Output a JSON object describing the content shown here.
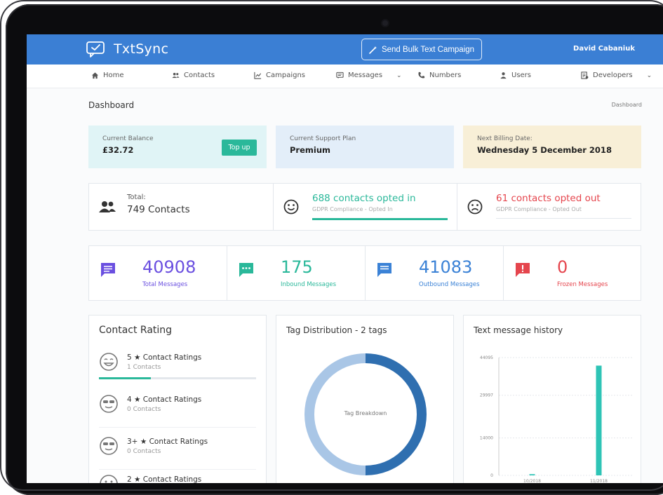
{
  "app": {
    "name": "TxtSync",
    "bulk_button": "Send Bulk Text Campaign",
    "user_name": "David Cabaniuk"
  },
  "nav": {
    "items": [
      {
        "label": "Home",
        "icon": "home-icon"
      },
      {
        "label": "Contacts",
        "icon": "contacts-icon"
      },
      {
        "label": "Campaigns",
        "icon": "chart-icon"
      },
      {
        "label": "Messages",
        "icon": "message-icon",
        "dropdown": true
      },
      {
        "label": "Numbers",
        "icon": "phone-icon"
      },
      {
        "label": "Users",
        "icon": "user-icon"
      },
      {
        "label": "Developers",
        "icon": "code-icon",
        "dropdown": true
      }
    ]
  },
  "page": {
    "title": "Dashboard",
    "breadcrumb": "Dashboard"
  },
  "info_cards": {
    "balance": {
      "label": "Current Balance",
      "value": "£32.72",
      "button": "Top up",
      "bg": "#e0f4f6"
    },
    "plan": {
      "label": "Current Support Plan",
      "value": "Premium",
      "bg": "#e3eef9"
    },
    "billing": {
      "label": "Next Billing Date:",
      "value": "Wednesday 5 December 2018",
      "bg": "#f8efd7"
    }
  },
  "contacts": {
    "total_label": "Total:",
    "total_value": "749 Contacts",
    "opted_in": {
      "title": "688 contacts opted in",
      "sub": "GDPR Compliance - Opted In",
      "color": "#2ab89a",
      "progress": 1.0
    },
    "opted_out": {
      "title": "61 contacts opted out",
      "sub": "GDPR Compliance - Opted Out",
      "color": "#e5454d",
      "progress": 0
    }
  },
  "messages": [
    {
      "value": "40908",
      "label": "Total Messages",
      "color": "#6a4fe0",
      "icon": "message-icon"
    },
    {
      "value": "175",
      "label": "Inbound Messages",
      "color": "#2ab89a",
      "icon": "inbound-icon"
    },
    {
      "value": "41083",
      "label": "Outbound Messages",
      "color": "#3b82d6",
      "icon": "outbound-icon"
    },
    {
      "value": "0",
      "label": "Frozen Messages",
      "color": "#e5454d",
      "icon": "alert-icon"
    }
  ],
  "contact_rating": {
    "title": "Contact Rating",
    "items": [
      {
        "title": "5 ★ Contact Ratings",
        "sub": "1 Contacts",
        "progress": 0.33
      },
      {
        "title": "4 ★ Contact Ratings",
        "sub": "0 Contacts",
        "progress": 0
      },
      {
        "title": "3+ ★ Contact Ratings",
        "sub": "0 Contacts",
        "progress": 0
      },
      {
        "title": "2 ★ Contact Ratings",
        "sub": "",
        "progress": 0
      }
    ]
  },
  "tag_distribution": {
    "title": "Tag Distribution - 2 tags",
    "center_label": "Tag Breakdown"
  },
  "chart_data": {
    "type": "bar",
    "title": "Text message history",
    "categories": [
      "10/2018",
      "11/2018"
    ],
    "values": [
      450,
      41083
    ],
    "yticks": [
      "0",
      "14000",
      "29997",
      "44095"
    ],
    "ylim": [
      0,
      44095
    ],
    "color": "#2ec4b6",
    "grid": true
  },
  "donut_data": {
    "type": "pie",
    "values": [
      50,
      50
    ],
    "colors": [
      "#2f6fb0",
      "#a9c6e6"
    ]
  }
}
